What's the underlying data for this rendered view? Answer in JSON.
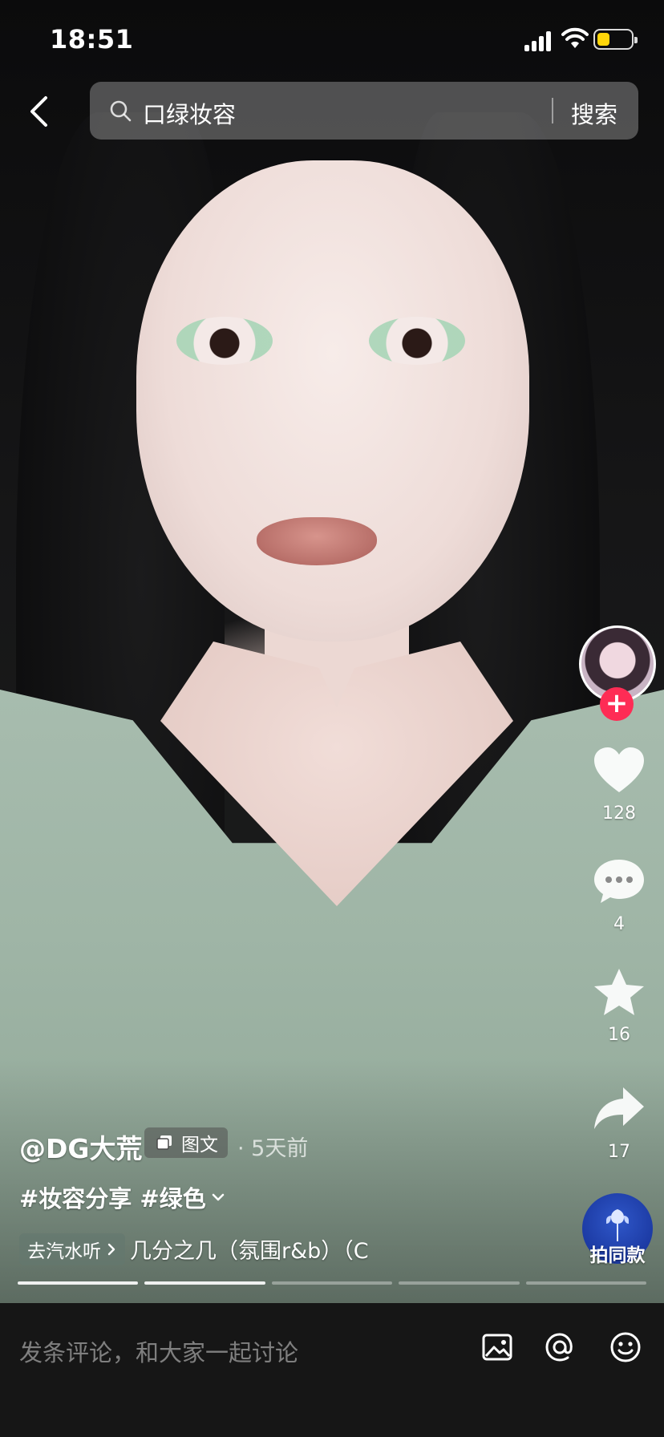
{
  "status_bar": {
    "time": "18:51",
    "battery_color": "#ffd60a"
  },
  "search": {
    "query": "口绿妆容",
    "button_label": "搜索"
  },
  "post": {
    "author": "@DG大荒",
    "type_label": "图文",
    "time_ago": "· 5天前",
    "hashtags": "#妆容分享 #绿色",
    "music_chip": "去汽水听",
    "music_title": "几分之几（氛围r&b）（C",
    "progress_total": 5,
    "progress_done": 2
  },
  "actions": {
    "follow": "+",
    "likes": "128",
    "comments": "4",
    "favorites": "16",
    "shares": "17",
    "same_style": "拍同款"
  },
  "comment_bar": {
    "placeholder": "发条评论，和大家一起讨论"
  },
  "colors": {
    "follow_red": "#fe2c55",
    "comment_bg": "#161616"
  }
}
